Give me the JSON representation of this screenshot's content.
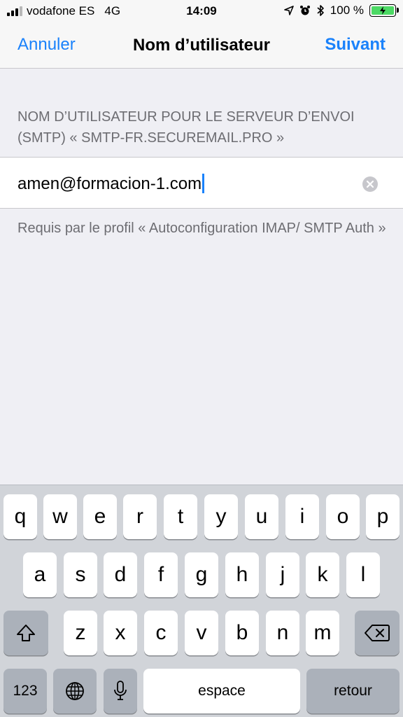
{
  "status_bar": {
    "carrier": "vodafone ES",
    "network": "4G",
    "time": "14:09",
    "battery_percent": "100 %",
    "battery_color": "#4cd964",
    "icons": [
      "location-arrow-icon",
      "alarm-icon",
      "bluetooth-icon",
      "battery-charging-icon"
    ]
  },
  "nav": {
    "cancel_label": "Annuler",
    "title": "Nom d’utilisateur",
    "next_label": "Suivant",
    "accent": "#1a82fb"
  },
  "form": {
    "section_header": "Nom d’utilisateur pour le serveur d’envoi (SMTP) « smtp-fr.securemail.pro »",
    "field_value": "amen@formacion-1.com",
    "clear_icon": "clear-circle-icon",
    "footer": "Requis par le profil « Autoconfiguration IMAP/ SMTP Auth »"
  },
  "keyboard": {
    "row1": [
      "q",
      "w",
      "e",
      "r",
      "t",
      "y",
      "u",
      "i",
      "o",
      "p"
    ],
    "row2": [
      "a",
      "s",
      "d",
      "f",
      "g",
      "h",
      "j",
      "k",
      "l"
    ],
    "row3": [
      "z",
      "x",
      "c",
      "v",
      "b",
      "n",
      "m"
    ],
    "shift_icon": "shift-icon",
    "delete_icon": "delete-backward-icon",
    "numbers_label": "123",
    "globe_icon": "globe-icon",
    "mic_icon": "microphone-icon",
    "space_label": "espace",
    "return_label": "retour"
  }
}
